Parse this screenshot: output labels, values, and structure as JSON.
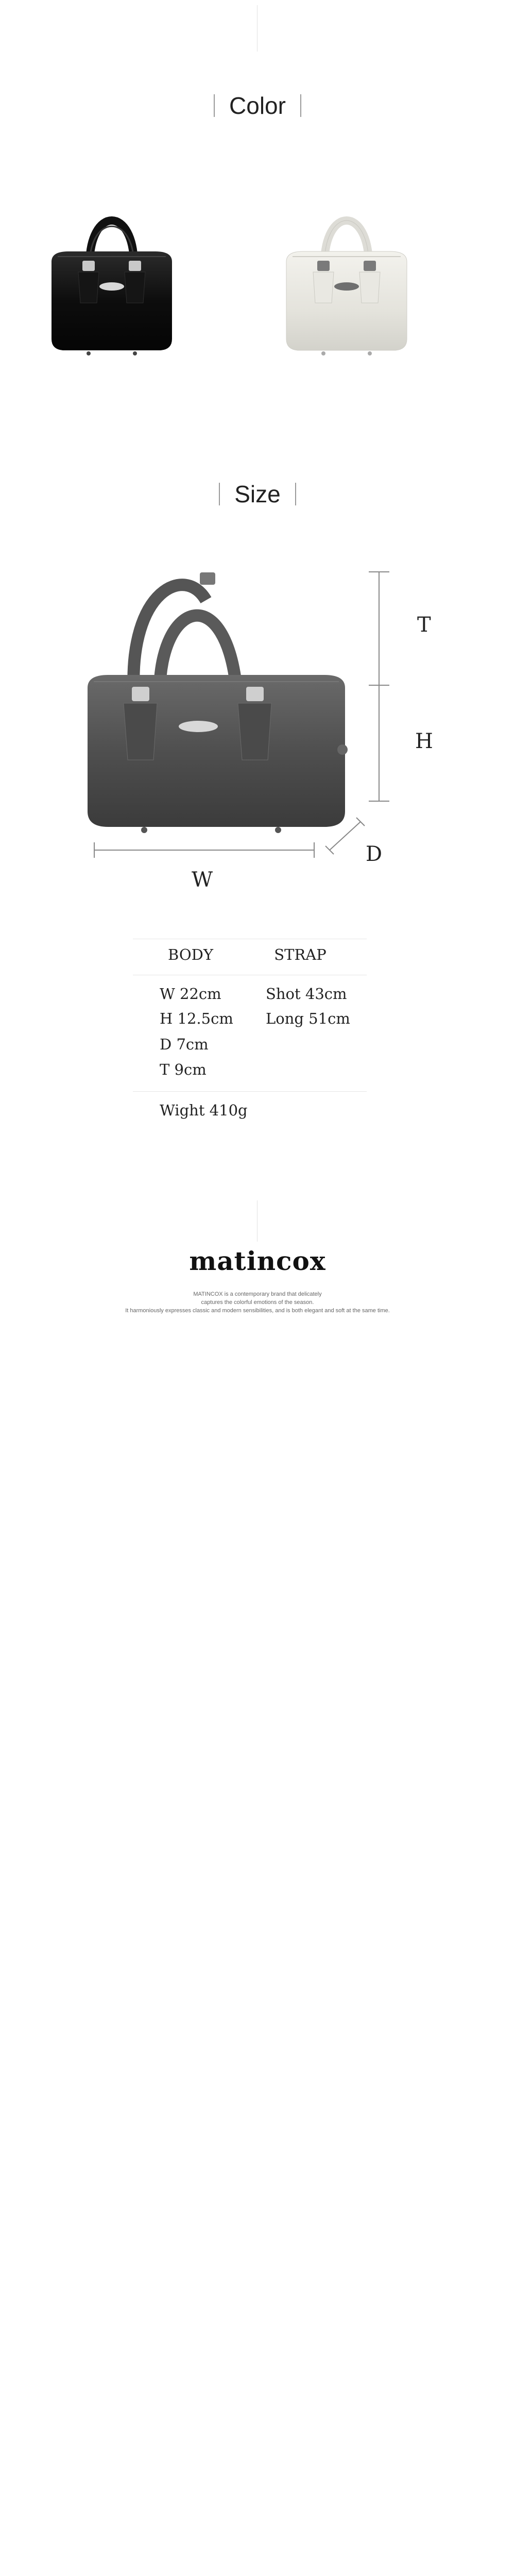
{
  "color_section": {
    "title": "Color",
    "variants": [
      {
        "name": "black-bag",
        "color": "#101010"
      },
      {
        "name": "ivory-bag",
        "color": "#e7e6e0"
      }
    ]
  },
  "size_section": {
    "title": "Size",
    "dimension_labels": {
      "t": "T",
      "h": "H",
      "w": "W",
      "d": "D"
    }
  },
  "spec_table": {
    "headers": {
      "body": "BODY",
      "strap": "STRAP"
    },
    "body": {
      "w": "W  22cm",
      "h": "H  12.5cm",
      "d": "D  7cm",
      "t": "T  9cm"
    },
    "strap": {
      "short": "Shot  43cm",
      "long": "Long  51cm"
    },
    "weight": "Wight  410g"
  },
  "brand": {
    "name": "matincox",
    "line1": "MATINCOX is a contemporary brand that delicately",
    "line2": "captures the colorful emotions of the season.",
    "line3": "It harmoniously expresses classic and modern sensibilities, and is both elegant and soft at the same time."
  }
}
